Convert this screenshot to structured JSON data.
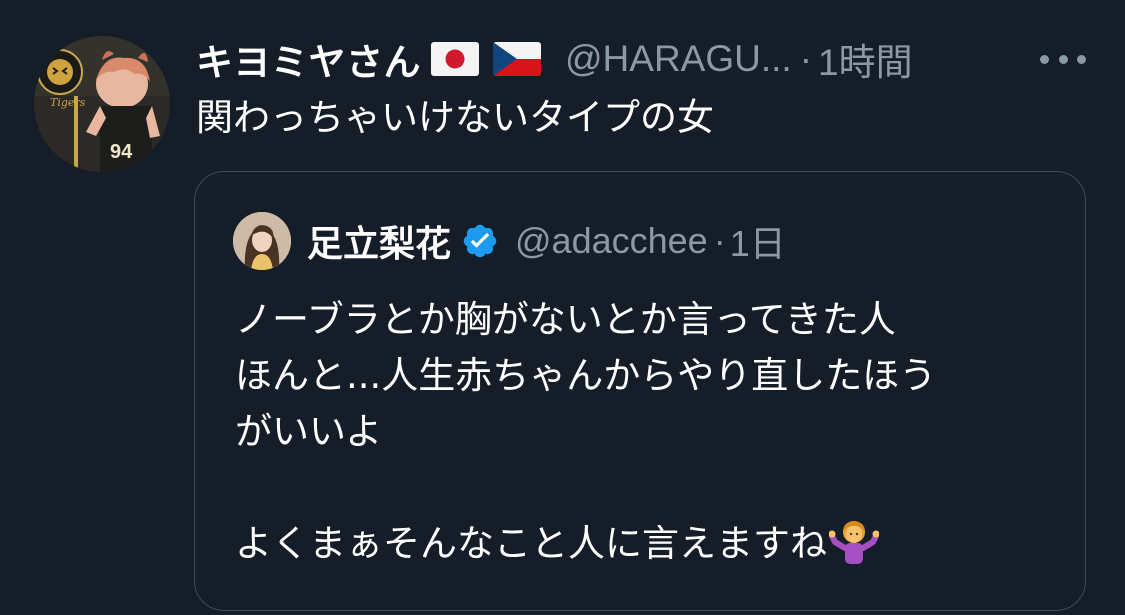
{
  "tweet": {
    "display_name": "キヨミヤさん",
    "flags": [
      "japan-flag",
      "czech-flag"
    ],
    "handle": "@HARAGU...",
    "separator": "·",
    "time": "1時間",
    "text": "関わっちゃいけないタイプの女",
    "avatar": {
      "jersey_number": "94",
      "tag_text": "Tigers"
    }
  },
  "quote": {
    "display_name": "足立梨花",
    "handle": "@adacchee",
    "separator": "·",
    "time": "1日",
    "lines": [
      "ノーブラとか胸がないとか言ってきた人",
      "ほんと...人生赤ちゃんからやり直したほう",
      "がいいよ",
      "",
      "よくまぁそんなこと人に言えますね"
    ],
    "emoji": "woman-shrugging-icon"
  },
  "colors": {
    "background": "#151d28",
    "text_primary": "#ffffff",
    "text_secondary": "#8b98a5",
    "card_border": "#3e4a57",
    "verified": "#1d9bf0"
  }
}
